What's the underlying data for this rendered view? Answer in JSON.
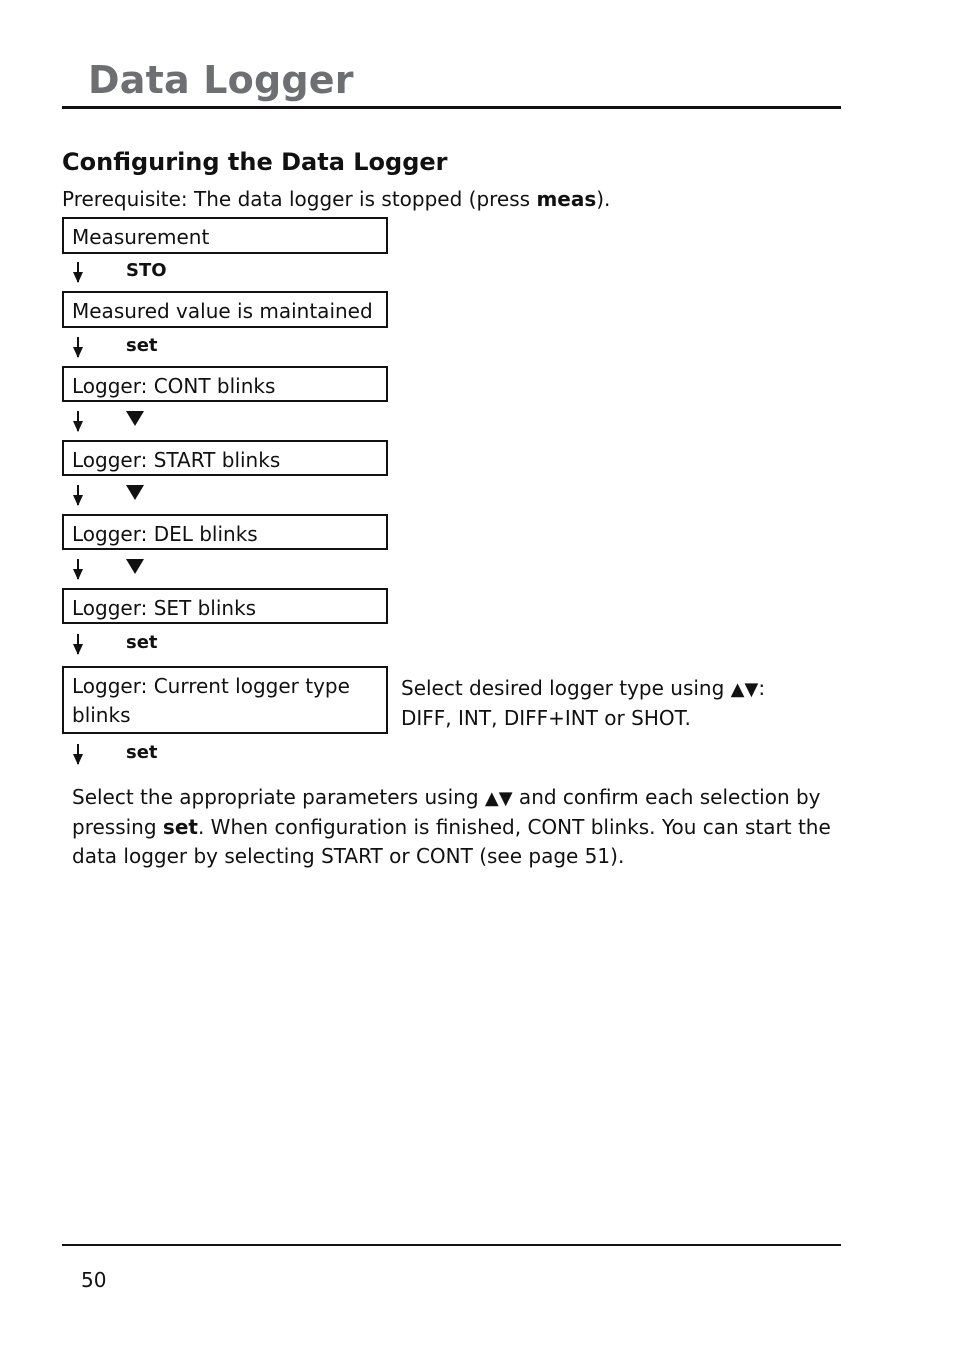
{
  "header": {
    "title": "Data Logger"
  },
  "section": {
    "heading": "Configuring the Data Logger",
    "prerequisite": {
      "prefix": "Prerequisite: The data logger is stopped (press ",
      "key": "meas",
      "suffix": ")."
    }
  },
  "flow": {
    "boxes": [
      "Measurement",
      "Measured value is maintained",
      "Logger: CONT blinks",
      "Logger: START blinks",
      "Logger: DEL blinks",
      "Logger: SET blinks",
      "Logger: Current logger type blinks"
    ],
    "steps": [
      {
        "type": "key",
        "label": "STO"
      },
      {
        "type": "key",
        "label": "set"
      },
      {
        "type": "icon",
        "icon": "down-triangle-icon"
      },
      {
        "type": "icon",
        "icon": "down-triangle-icon"
      },
      {
        "type": "icon",
        "icon": "down-triangle-icon"
      },
      {
        "type": "key",
        "label": "set"
      },
      {
        "type": "key",
        "label": "set"
      }
    ],
    "side_note": {
      "line1_prefix": "Select desired logger type using ",
      "line1_symbols": "▲▼",
      "line1_suffix": ":",
      "line2": "DIFF, INT, DIFF+INT or SHOT."
    }
  },
  "paragraph": {
    "part1": "Select the appropriate parameters using ",
    "symbols": "▲▼",
    "part2": " and confirm each selection by pressing ",
    "key": "set",
    "part3": ". When configuration is finished, CONT blinks. You can start the data logger by selecting START or CONT (see page 51)."
  },
  "footer": {
    "page_number": "50"
  }
}
